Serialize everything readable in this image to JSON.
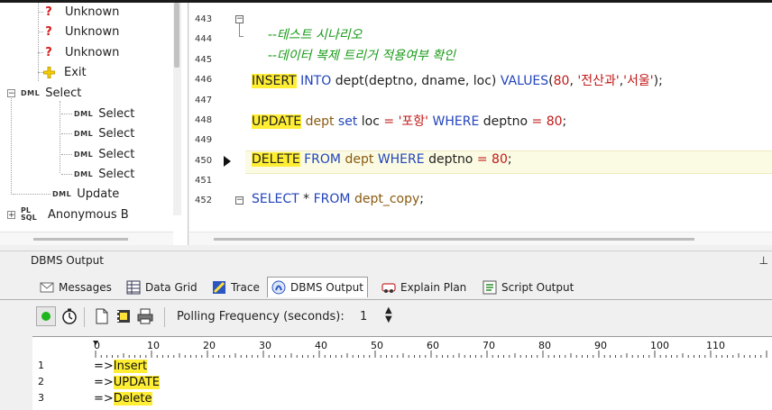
{
  "tree": {
    "items": [
      {
        "label": "Unknown",
        "icon": "question-icon"
      },
      {
        "label": "Unknown",
        "icon": "question-icon"
      },
      {
        "label": "Unknown",
        "icon": "question-icon"
      },
      {
        "label": "Exit",
        "icon": "exit-icon"
      },
      {
        "label": "Select",
        "icon": "dml-icon",
        "icon_text": "DML",
        "expander": "−"
      },
      {
        "label": "Select",
        "icon": "dml-icon",
        "icon_text": "DML"
      },
      {
        "label": "Select",
        "icon": "dml-icon",
        "icon_text": "DML"
      },
      {
        "label": "Select",
        "icon": "dml-icon",
        "icon_text": "DML"
      },
      {
        "label": "Select",
        "icon": "dml-icon",
        "icon_text": "DML"
      },
      {
        "label": "Update",
        "icon": "dml-icon",
        "icon_text": "DML"
      },
      {
        "label": "Anonymous B",
        "icon": "plsql-icon",
        "icon_text": "PL SQL",
        "expander": "+"
      }
    ]
  },
  "editor": {
    "lines": [
      {
        "num": "443",
        "text": "--테스트 시나리오"
      },
      {
        "num": "444",
        "text": "--데이터 복제 트리거 적용여부 확인"
      },
      {
        "num": "445",
        "text": ""
      },
      {
        "num": "446",
        "text": "INSERT INTO dept(deptno, dname, loc) VALUES(80, '전산과','서울');"
      },
      {
        "num": "447",
        "text": ""
      },
      {
        "num": "448",
        "text": "UPDATE dept set loc = '포항' WHERE deptno = 80;"
      },
      {
        "num": "449",
        "text": ""
      },
      {
        "num": "450",
        "text": "DELETE FROM dept WHERE deptno = 80;"
      },
      {
        "num": "451",
        "text": ""
      },
      {
        "num": "452",
        "text": "SELECT * FROM dept_copy;"
      }
    ],
    "tokens": {
      "cmt1": "--테스트 시나리오",
      "cmt2": "--데이터 복제 트리거 적용여부 확인",
      "insert": "INSERT",
      "into": "INTO",
      "ins_rest": "dept(deptno, dname, loc)",
      "values": "VALUES",
      "ins_paren": "(",
      "ins_num": "80",
      "ins_comma": ",",
      "str1": "'전산과'",
      "comma2": ",",
      "str2": "'서울'",
      "ins_end": ");",
      "update": "UPDATE",
      "upd_dept": "dept",
      "upd_set": "set",
      "upd_loc": "loc",
      "eq": "=",
      "str3": "'포항'",
      "where": "WHERE",
      "upd_deptno": "deptno",
      "eq2": "=",
      "upd_num": "80",
      "semi": ";",
      "delete": "DELETE",
      "from": "FROM",
      "del_dept": "dept",
      "where2": "WHERE",
      "del_deptno": "deptno",
      "eq3": "=",
      "del_num": "80",
      "semi2": ";",
      "select": "SELECT",
      "star": "*",
      "from2": "FROM",
      "sel_tbl": "dept_copy",
      "semi3": ";"
    },
    "current_line_marker": "450"
  },
  "panel": {
    "title": "DBMS Output",
    "pin": "ꟷ"
  },
  "tabs": [
    {
      "label": "Messages",
      "icon": "messages-icon"
    },
    {
      "label": "Data Grid",
      "icon": "data-grid-icon"
    },
    {
      "label": "Trace",
      "icon": "trace-icon"
    },
    {
      "label": "DBMS Output",
      "icon": "dbms-output-icon",
      "active": true
    },
    {
      "label": "Explain Plan",
      "icon": "explain-plan-icon"
    },
    {
      "label": "Script Output",
      "icon": "script-output-icon"
    }
  ],
  "toolbar": {
    "polling_label": "Polling Frequency (seconds):",
    "polling_value": "1"
  },
  "ruler": {
    "labels": [
      "0",
      "10",
      "20",
      "30",
      "40",
      "50",
      "60",
      "70",
      "80",
      "90",
      "100",
      "110"
    ]
  },
  "output": {
    "rows": [
      {
        "num": "1",
        "prefix": "=>",
        "text": "Insert"
      },
      {
        "num": "2",
        "prefix": "=>",
        "text": "UPDATE"
      },
      {
        "num": "3",
        "prefix": "=>",
        "text": "Delete"
      }
    ]
  },
  "colors": {
    "highlight": "#ffee33",
    "keyword": "#2244bb",
    "string": "#c01818",
    "comment": "#1a9a1a",
    "table": "#8a5a10"
  }
}
